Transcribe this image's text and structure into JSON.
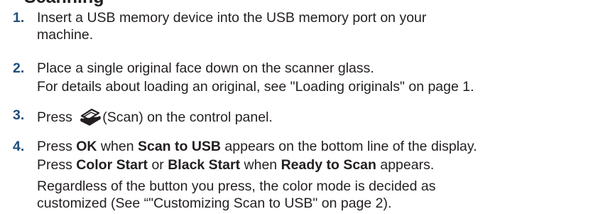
{
  "heading": "Scanning",
  "steps": [
    {
      "number": "1.",
      "line1": "Insert a USB memory device into the USB memory port on your",
      "line2": "machine."
    },
    {
      "number": "2.",
      "text": "Place a single original face down on the scanner glass.",
      "note": "For details about loading an original, see \"Loading originals\" on page 1."
    },
    {
      "number": "3.",
      "before": "Press ",
      "icon": "scan-icon",
      "after": "(Scan) on the control panel."
    },
    {
      "number": "4.",
      "p1": "Press ",
      "b1": "OK",
      "p2": " when ",
      "b2": "Scan to USB",
      "p3": " appears on the bottom line of the display.",
      "q1": "Press ",
      "qb1": "Color Start",
      "q2": " or ",
      "qb2": "Black Start",
      "q3": " when ",
      "qb3": "Ready to Scan",
      "q4": " appears.",
      "r1": "Regardless of the button you press, the color mode is decided as",
      "r2": "customized (See “\"Customizing Scan to USB\" on page 2)."
    }
  ]
}
